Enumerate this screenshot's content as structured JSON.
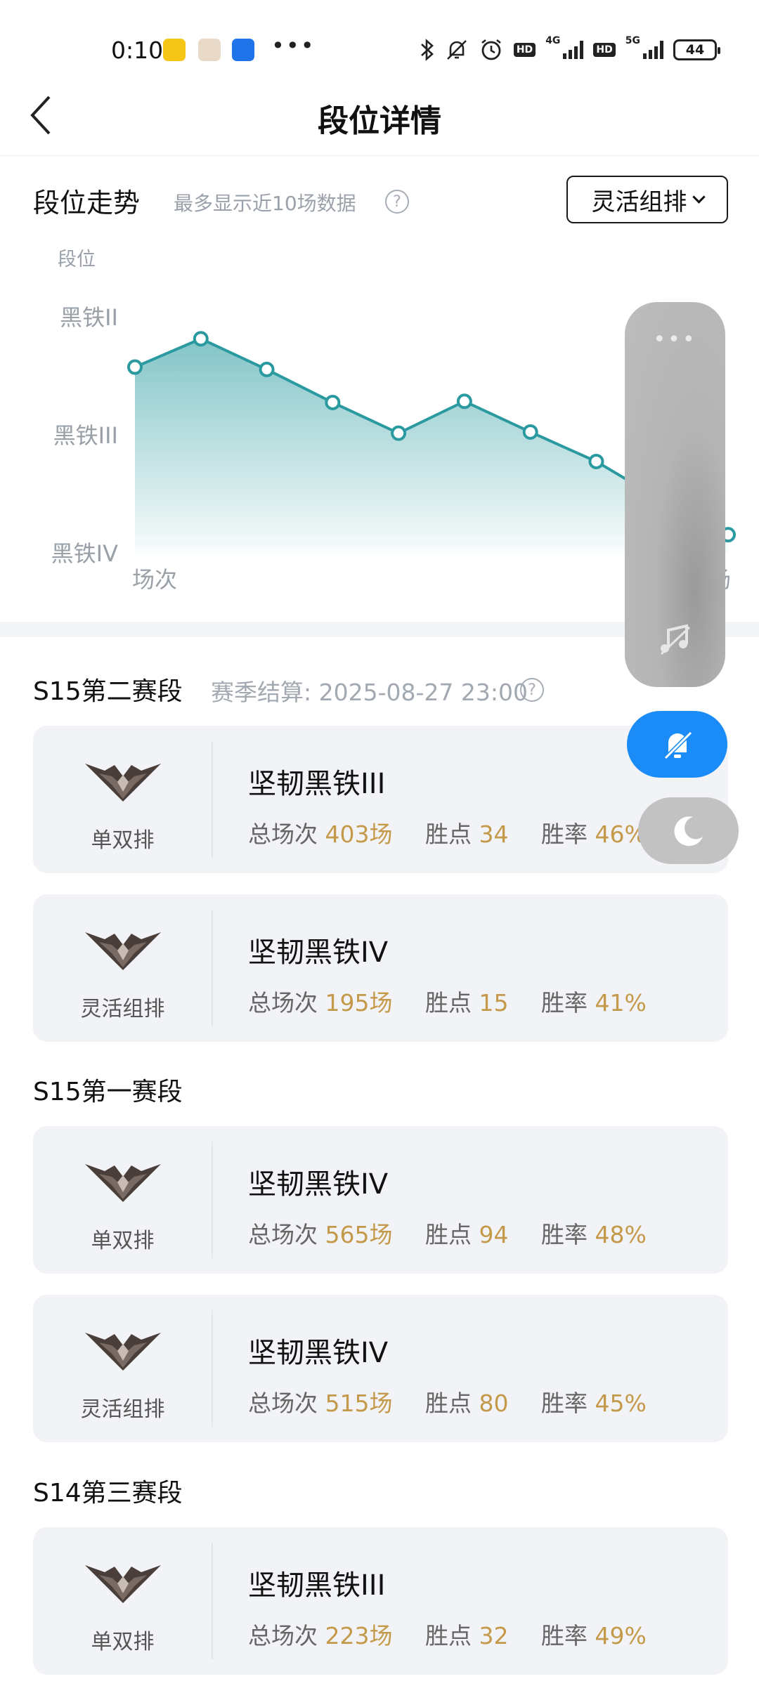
{
  "status_bar": {
    "time": "0:10",
    "net_4g": "4G",
    "net_5g": "5G",
    "hd": "HD",
    "battery": "44"
  },
  "header": {
    "title": "段位详情"
  },
  "trend": {
    "title": "段位走势",
    "note": "最多显示近10场数据",
    "help": "?",
    "queue_select": "灵活组排"
  },
  "chart_data": {
    "type": "area",
    "ylabel": "段位",
    "xlabel": "场次",
    "y_ticks": [
      "黑铁IV",
      "黑铁III",
      "黑铁II"
    ],
    "x_partial_label": "场",
    "ylim": [
      0,
      2
    ],
    "values": [
      1.58,
      1.82,
      1.56,
      1.28,
      1.02,
      1.29,
      1.03,
      0.78,
      0.45,
      0.16
    ],
    "line_color": "#2a9aa0",
    "fill_color": "#7cc1c4"
  },
  "seasons": [
    {
      "title": "S15第二赛段",
      "note": "赛季结算: 2025-08-27 23:00",
      "help": "?",
      "cards": [
        {
          "queue": "单双排",
          "rank": "坚韧黑铁III",
          "games_label": "总场次",
          "games": "403场",
          "lp_label": "胜点",
          "lp": "34",
          "wr_label": "胜率",
          "wr": "46%"
        },
        {
          "queue": "灵活组排",
          "rank": "坚韧黑铁IV",
          "games_label": "总场次",
          "games": "195场",
          "lp_label": "胜点",
          "lp": "15",
          "wr_label": "胜率",
          "wr": "41%"
        }
      ]
    },
    {
      "title": "S15第一赛段",
      "cards": [
        {
          "queue": "单双排",
          "rank": "坚韧黑铁IV",
          "games_label": "总场次",
          "games": "565场",
          "lp_label": "胜点",
          "lp": "94",
          "wr_label": "胜率",
          "wr": "48%"
        },
        {
          "queue": "灵活组排",
          "rank": "坚韧黑铁IV",
          "games_label": "总场次",
          "games": "515场",
          "lp_label": "胜点",
          "lp": "80",
          "wr_label": "胜率",
          "wr": "45%"
        }
      ]
    },
    {
      "title": "S14第三赛段",
      "cards": [
        {
          "queue": "单双排",
          "rank": "坚韧黑铁III",
          "games_label": "总场次",
          "games": "223场",
          "lp_label": "胜点",
          "lp": "32",
          "wr_label": "胜率",
          "wr": "49%"
        }
      ]
    }
  ],
  "floating_panel": {
    "dots": "•••"
  },
  "icons": [
    "back-arrow-icon",
    "help-icon",
    "chevron-down-icon",
    "iron-rank-emblem-icon",
    "music-off-icon",
    "bell-mute-icon",
    "moon-icon",
    "bluetooth-icon",
    "alarm-icon",
    "weibo-app-icon"
  ]
}
